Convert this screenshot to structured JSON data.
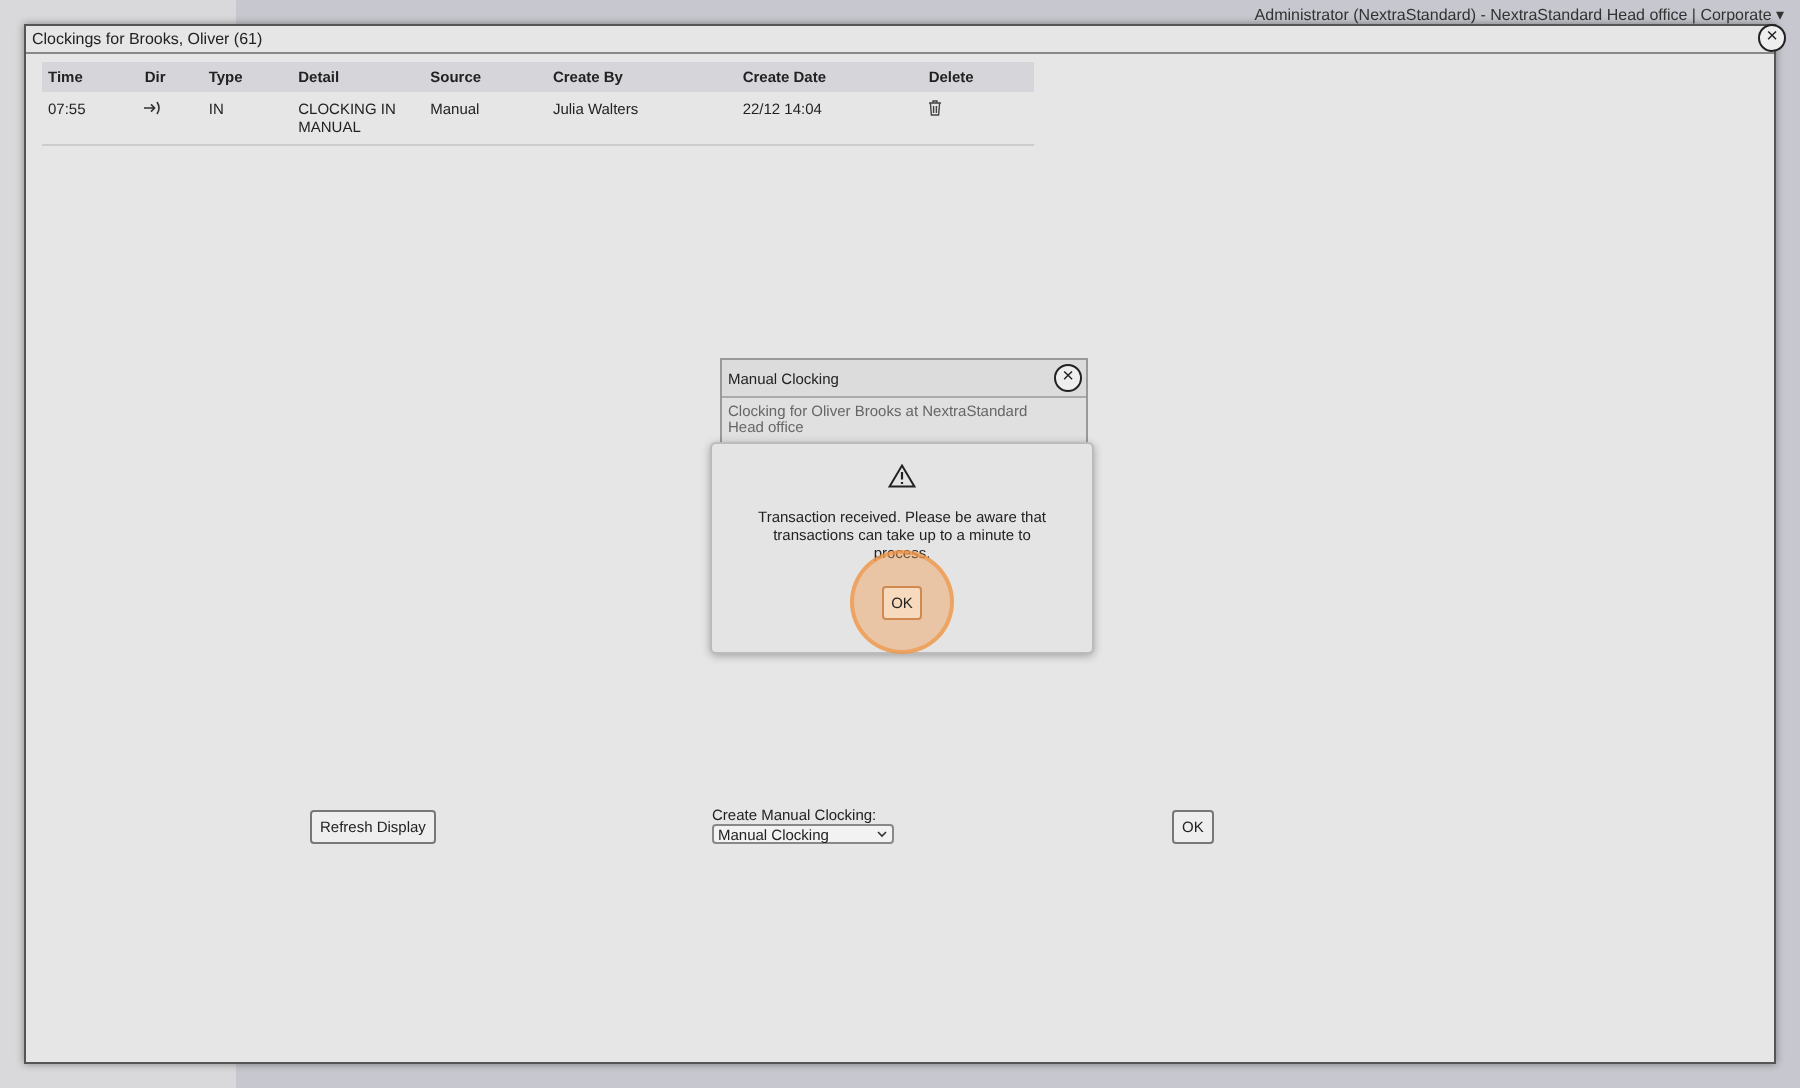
{
  "header": {
    "user": "Administrator (NextraStandard) - NextraStandard Head office | Corporate ▾"
  },
  "window": {
    "title": "Clockings for Brooks, Oliver (61)",
    "close": "×"
  },
  "table": {
    "columns": [
      "Time",
      "Dir",
      "Type",
      "Detail",
      "Source",
      "Create By",
      "Create Date",
      "Delete"
    ],
    "rows": [
      {
        "time": "07:55",
        "type": "IN",
        "detail": "CLOCKING IN MANUAL",
        "source": "Manual",
        "create_by": "Julia Walters",
        "create_date": "22/12 14:04"
      }
    ]
  },
  "manual_dialog": {
    "title": "Manual Clocking",
    "close": "×",
    "message": "Clocking for Oliver Brooks at NextraStandard Head office"
  },
  "alert": {
    "message": "Transaction received. Please be aware that transactions can take up to a minute to process.",
    "button": "OK",
    "highlighted": true
  },
  "footer": {
    "refresh": "Refresh Display",
    "create_label": "Create Manual Clocking:",
    "create_value": "Manual Clocking",
    "ok": "OK"
  }
}
